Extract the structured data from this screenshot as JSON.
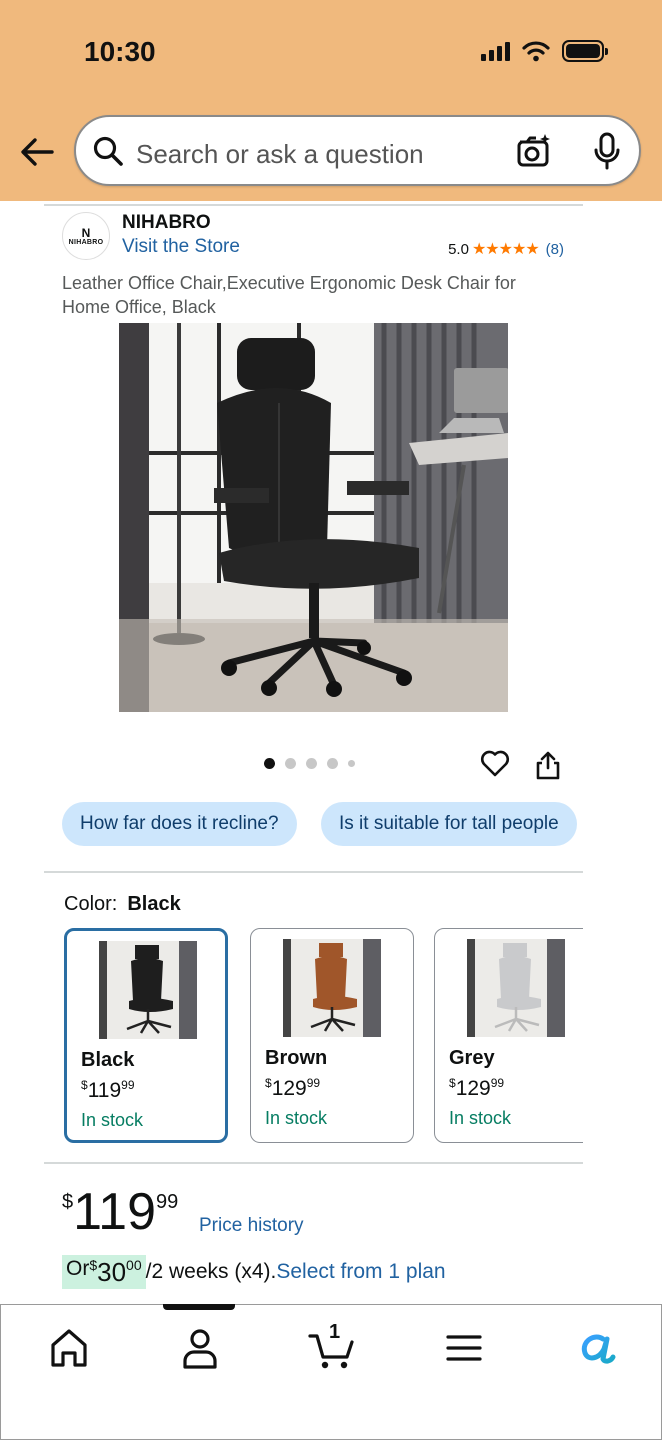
{
  "status_bar": {
    "time": "10:30"
  },
  "search": {
    "placeholder": "Search or ask a question"
  },
  "brand": {
    "logo_text": "NIHABRO",
    "name": "NIHABRO",
    "visit_store": "Visit the Store",
    "rating": "5.0",
    "stars": "★★★★★",
    "review_count": "(8)"
  },
  "product": {
    "title": "Leather Office Chair,Executive Ergonomic Desk Chair for Home Office, Black",
    "image_dots": 5,
    "active_image": 0
  },
  "questions": [
    "How far does it recline?",
    "Is it suitable for tall people"
  ],
  "color": {
    "label": "Color:",
    "selected": "Black",
    "options": [
      {
        "name": "Black",
        "currency": "$",
        "whole": "119",
        "fraction": "99",
        "stock": "In stock",
        "chair_color": "#1e1e1e"
      },
      {
        "name": "Brown",
        "currency": "$",
        "whole": "129",
        "fraction": "99",
        "stock": "In stock",
        "chair_color": "#a0562a"
      },
      {
        "name": "Grey",
        "currency": "$",
        "whole": "129",
        "fraction": "99",
        "stock": "In stock",
        "chair_color": "#c9cacc"
      }
    ]
  },
  "price": {
    "currency": "$",
    "whole": "119",
    "fraction": "99",
    "history_link": "Price history",
    "installment_prefix": "Or ",
    "installment_currency": "$",
    "installment_whole": "30",
    "installment_fraction": "00",
    "installment_suffix": "/2 weeks (x4).",
    "installment_plan": "Select from 1 plan"
  },
  "bottom_nav": {
    "items": [
      "home-icon",
      "account-icon",
      "cart-icon",
      "menu-icon",
      "rufus-icon"
    ],
    "cart_count": "1"
  },
  "colors": {
    "header": "#f0b97d",
    "link": "#2162a1",
    "stock": "#067d62",
    "chip": "#cde6fc",
    "star": "#ff7a00",
    "selected_border": "#2a6ea3"
  }
}
